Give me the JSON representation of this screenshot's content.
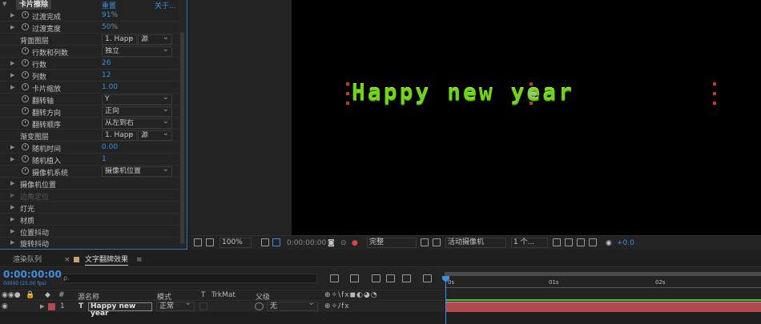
{
  "effect_controls": {
    "effect_name": "卡片擦除",
    "reset_label": "重置",
    "about_label": "关于...",
    "rows": [
      {
        "label": "过渡完成",
        "value": "91",
        "unit": "%"
      },
      {
        "label": "过渡宽度",
        "value": "50",
        "unit": "%"
      },
      {
        "label": "背面图层",
        "dropdown": "1. Happ",
        "dropdown2": "源"
      },
      {
        "label": "行数和列数",
        "dropdown": "独立"
      },
      {
        "label": "行数",
        "value": "26"
      },
      {
        "label": "列数",
        "value": "12"
      },
      {
        "label": "卡片缩放",
        "value": "1.00"
      },
      {
        "label": "翻转轴",
        "dropdown": "Y"
      },
      {
        "label": "翻转方向",
        "dropdown": "正向"
      },
      {
        "label": "翻转顺序",
        "dropdown": "从左到右"
      },
      {
        "label": "渐变图层",
        "dropdown": "1. Happ",
        "dropdown2": "源"
      },
      {
        "label": "随机时间",
        "value": "0.00"
      },
      {
        "label": "随机植入",
        "value": "1"
      },
      {
        "label": "摄像机系统",
        "dropdown": "摄像机位置"
      },
      {
        "label": "摄像机位置"
      },
      {
        "label": "边角定位"
      },
      {
        "label": "灯光"
      },
      {
        "label": "材质"
      },
      {
        "label": "位置抖动"
      },
      {
        "label": "旋转抖动"
      }
    ]
  },
  "composition": {
    "text": "Happy new year",
    "text_color": "#6dd416"
  },
  "viewer_bar": {
    "zoom": "100%",
    "timecode": "0:00:00:00",
    "resolution": "完整",
    "camera": "活动摄像机",
    "views": "1 个...",
    "exposure": "+0.0"
  },
  "timeline": {
    "tabs": [
      "渲染队列",
      "文字翻牌效果"
    ],
    "timecode": "0:00:00:00",
    "timecode_sub": "00000 (25.00 fps)",
    "search_placeholder": "ρ.",
    "columns": {
      "index": "#",
      "source_name": "源名称",
      "mode": "模式",
      "t": "T",
      "trkmat": "TrkMat",
      "parent": "父级"
    },
    "ruler": [
      "0s",
      "01s",
      "02s"
    ],
    "layer": {
      "index": "1",
      "type": "T",
      "name": "Happy new year",
      "mode": "正常",
      "parent": "无"
    }
  },
  "colors": {
    "accent": "#3d8fe0",
    "layer_bar": "#b04c50",
    "panel_border": "#2b78c2"
  }
}
